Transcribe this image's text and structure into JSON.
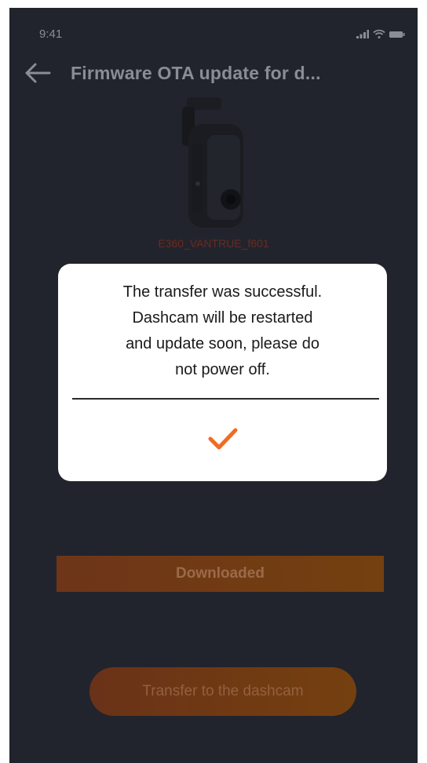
{
  "status_bar": {
    "time": "9:41",
    "icons": [
      "signal-icon",
      "wifi-icon",
      "battery-icon"
    ]
  },
  "header": {
    "back_icon": "back-arrow-icon",
    "title": "Firmware OTA update for d..."
  },
  "device": {
    "image": "dashcam-image",
    "name": "E360_VANTRUE_f601"
  },
  "background": {
    "progress_label": "Downloaded",
    "transfer_button_label": "Transfer to the dashcam"
  },
  "dialog": {
    "message_lines": [
      "The transfer was successful.",
      "Dashcam will be restarted",
      "and update soon, please do",
      "not power off."
    ],
    "confirm_icon": "checkmark-icon"
  },
  "colors": {
    "background": "#22242d",
    "accent": "#f26b22",
    "dialog": "#ffffff"
  }
}
